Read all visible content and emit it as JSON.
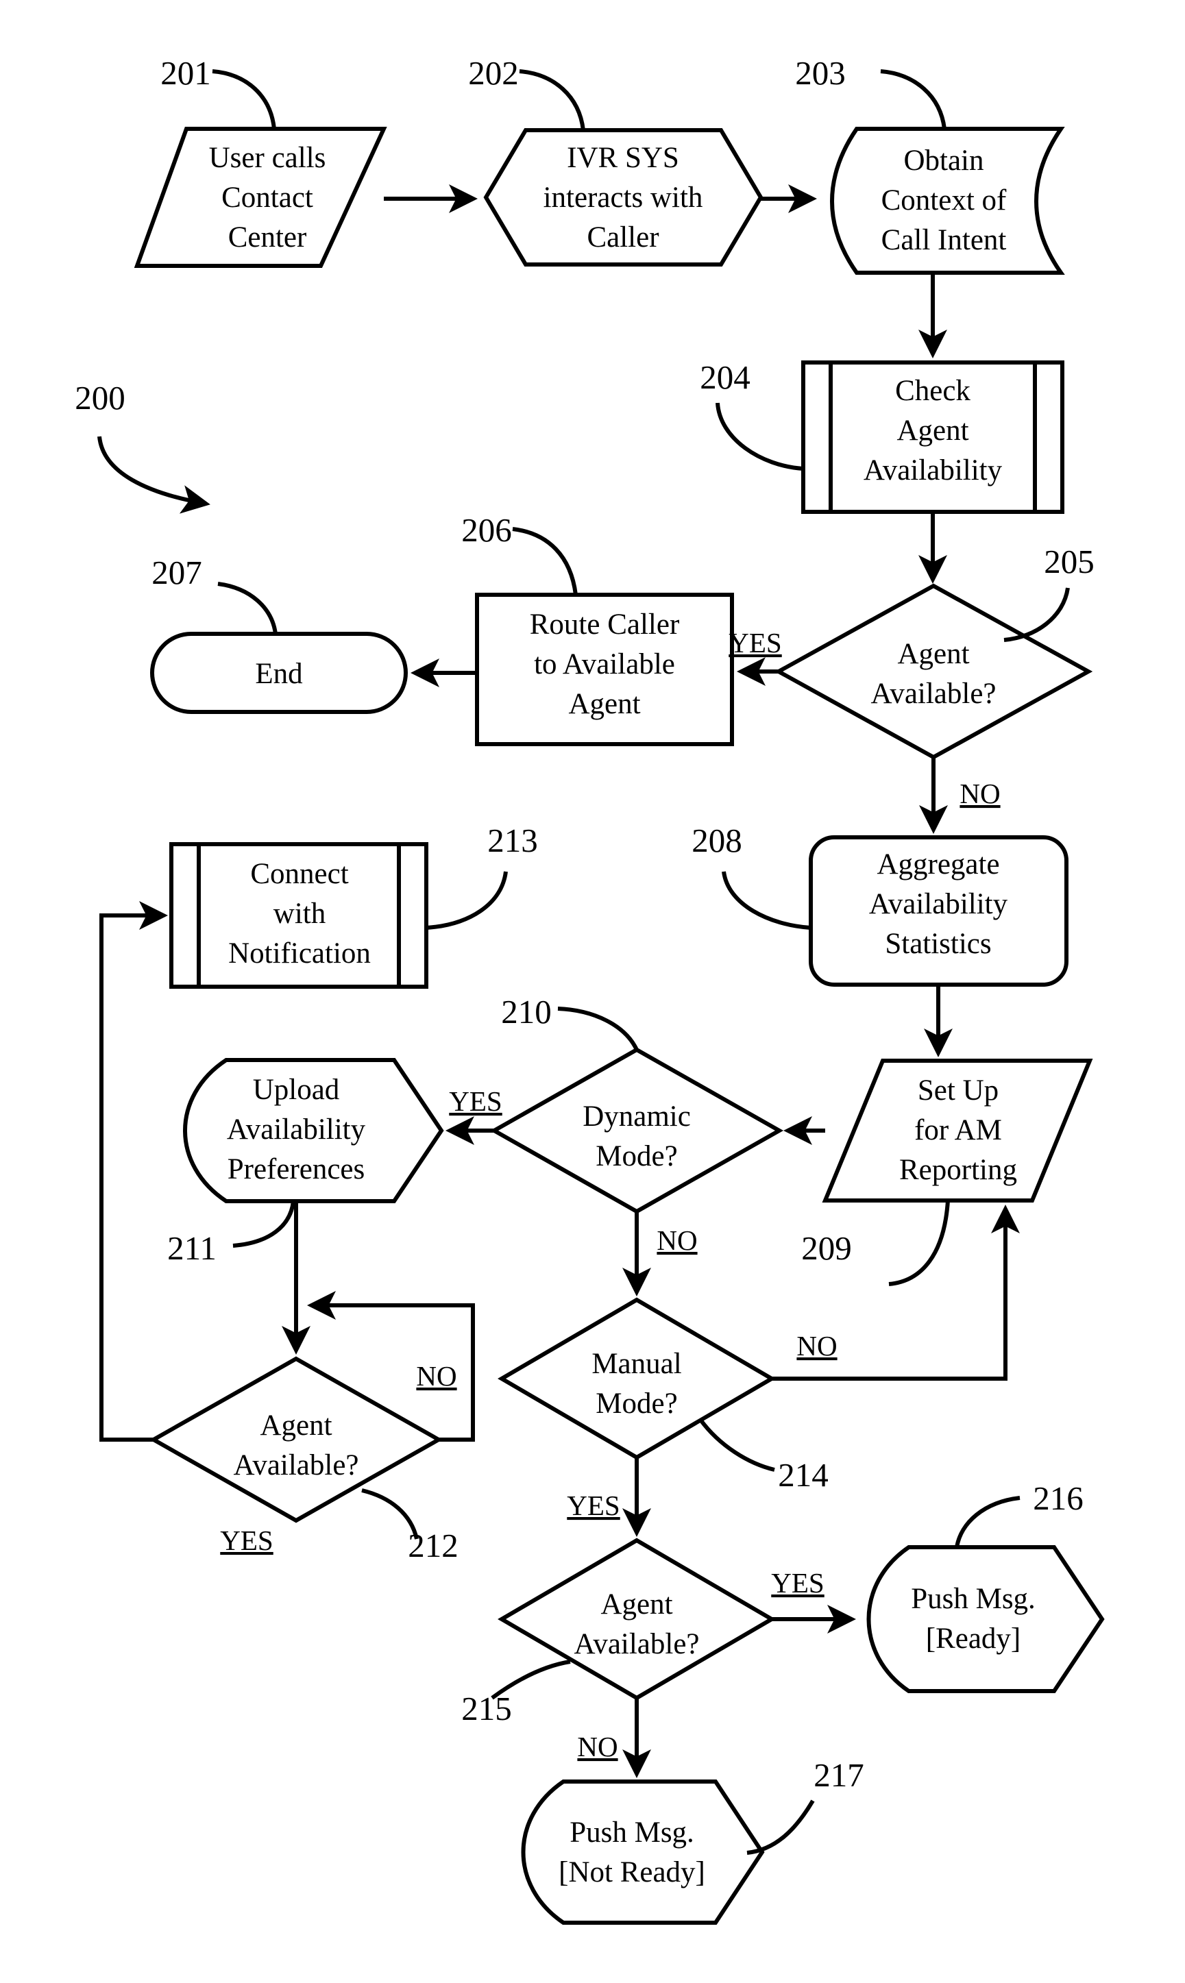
{
  "figure": {
    "ref_label": "200",
    "nodes": [
      {
        "id": "201",
        "ref": "201",
        "shape": "parallelogram",
        "lines": [
          "User calls",
          "Contact",
          "Center"
        ]
      },
      {
        "id": "202",
        "ref": "202",
        "shape": "hexagon",
        "lines": [
          "IVR SYS",
          "interacts with",
          "Caller"
        ]
      },
      {
        "id": "203",
        "ref": "203",
        "shape": "curved-ends",
        "lines": [
          "Obtain",
          "Context of",
          "Call Intent"
        ]
      },
      {
        "id": "204",
        "ref": "204",
        "shape": "predefined-process",
        "lines": [
          "Check",
          "Agent",
          "Availability"
        ]
      },
      {
        "id": "205",
        "ref": "205",
        "shape": "diamond",
        "lines": [
          "Agent",
          "Available?"
        ]
      },
      {
        "id": "206",
        "ref": "206",
        "shape": "rectangle",
        "lines": [
          "Route Caller",
          "to Available",
          "Agent"
        ]
      },
      {
        "id": "207",
        "ref": "207",
        "shape": "stadium",
        "lines": [
          "End"
        ]
      },
      {
        "id": "208",
        "ref": "208",
        "shape": "rounded-rectangle",
        "lines": [
          "Aggregate",
          "Availability",
          "Statistics"
        ]
      },
      {
        "id": "209",
        "ref": "209",
        "shape": "parallelogram",
        "lines": [
          "Set Up",
          "for AM",
          "Reporting"
        ]
      },
      {
        "id": "210",
        "ref": "210",
        "shape": "diamond",
        "lines": [
          "Dynamic",
          "Mode?"
        ]
      },
      {
        "id": "211",
        "ref": "211",
        "shape": "display",
        "lines": [
          "Upload",
          "Availability",
          "Preferences"
        ]
      },
      {
        "id": "212",
        "ref": "212",
        "shape": "diamond",
        "lines": [
          "Agent",
          "Available?"
        ]
      },
      {
        "id": "213",
        "ref": "213",
        "shape": "predefined-process",
        "lines": [
          "Connect",
          "with",
          "Notification"
        ]
      },
      {
        "id": "214",
        "ref": "214",
        "shape": "diamond",
        "lines": [
          "Manual",
          "Mode?"
        ]
      },
      {
        "id": "215",
        "ref": "215",
        "shape": "diamond",
        "lines": [
          "Agent",
          "Available?"
        ]
      },
      {
        "id": "216",
        "ref": "216",
        "shape": "display",
        "lines": [
          "Push Msg.",
          "[Ready]"
        ]
      },
      {
        "id": "217",
        "ref": "217",
        "shape": "display",
        "lines": [
          "Push Msg.",
          "[Not Ready]"
        ]
      }
    ],
    "edge_labels": {
      "e205_yes": "YES",
      "e205_no": "NO",
      "e210_yes": "YES",
      "e210_no": "NO",
      "e212_no": "NO",
      "e212_yes": "YES",
      "e214_no": "NO",
      "e214_yes": "YES",
      "e215_yes": "YES",
      "e215_no": "NO"
    },
    "colors": {
      "ink": "#000000",
      "paper": "#ffffff"
    }
  }
}
